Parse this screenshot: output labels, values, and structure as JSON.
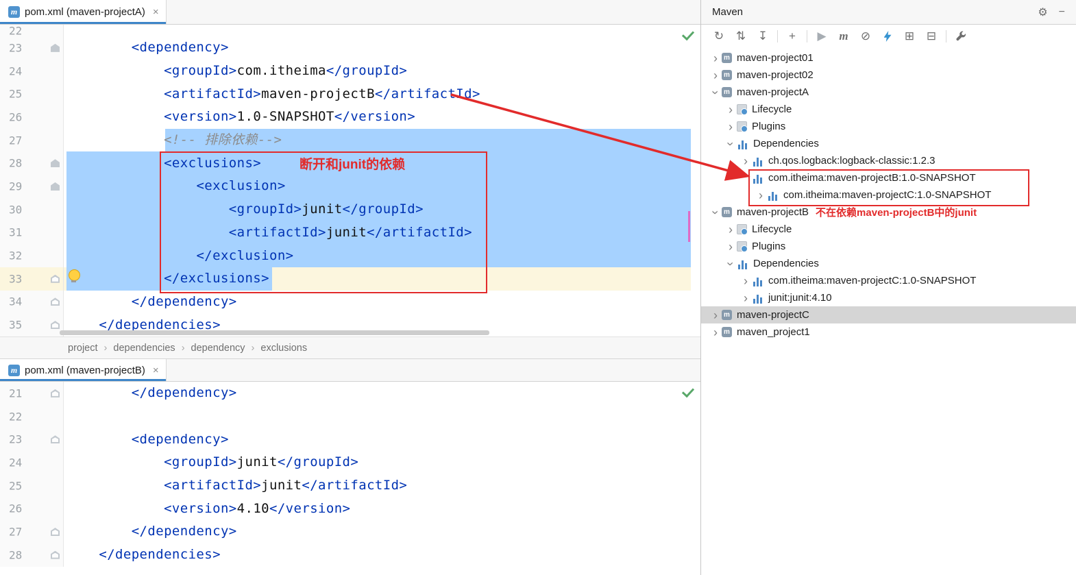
{
  "colors": {
    "accent_blue": "#3e86c9",
    "selection": "#a6d2ff",
    "caret_row": "#fcf6de",
    "error_red": "#e22b2b",
    "tag_blue": "#0033b3",
    "comment_gray": "#8c8c8c",
    "check_green": "#59a869",
    "bars_blue": "#4a88c7"
  },
  "icons": {
    "close": "×",
    "maven_file": "m",
    "module_letter": "m"
  },
  "top_window": {
    "tab": {
      "title": "pom.xml (maven-projectA)"
    },
    "annotation": "断开和junit的依赖",
    "breadcrumb": [
      "project",
      "dependencies",
      "dependency",
      "exclusions"
    ],
    "lines": [
      {
        "no": 22,
        "h": 17
      },
      {
        "no": 23,
        "ind": 8,
        "icon": "filled",
        "seg": [
          {
            "k": "tag",
            "t": "<dependency>"
          }
        ]
      },
      {
        "no": 24,
        "ind": 12,
        "seg": [
          {
            "k": "tag",
            "t": "<groupId>"
          },
          {
            "k": "txt",
            "t": "com.itheima"
          },
          {
            "k": "tag",
            "t": "</groupId>"
          }
        ]
      },
      {
        "no": 25,
        "ind": 12,
        "seg": [
          {
            "k": "tag",
            "t": "<artifactId>"
          },
          {
            "k": "txt",
            "t": "maven-projectB"
          },
          {
            "k": "tag",
            "t": "</artifactId>"
          }
        ]
      },
      {
        "no": 26,
        "ind": 12,
        "seg": [
          {
            "k": "tag",
            "t": "<version>"
          },
          {
            "k": "txt",
            "t": "1.0-SNAPSHOT"
          },
          {
            "k": "tag",
            "t": "</version>"
          }
        ]
      },
      {
        "no": 27,
        "ind": 12,
        "sel": {
          "from": 12,
          "to": "end"
        },
        "seg": [
          {
            "k": "com",
            "t": "<!-- 排除依赖-->"
          }
        ]
      },
      {
        "no": 28,
        "ind": 12,
        "icon": "filled",
        "sel": {
          "from": 0,
          "to": "end"
        },
        "seg": [
          {
            "k": "tag",
            "t": "<exclusions>"
          }
        ]
      },
      {
        "no": 29,
        "ind": 16,
        "icon": "filled",
        "sel": {
          "from": 0,
          "to": "end"
        },
        "seg": [
          {
            "k": "tag",
            "t": "<exclusion>"
          }
        ]
      },
      {
        "no": 30,
        "ind": 20,
        "sel": {
          "from": 0,
          "to": "end"
        },
        "seg": [
          {
            "k": "tag",
            "t": "<groupId>"
          },
          {
            "k": "txt",
            "t": "junit"
          },
          {
            "k": "tag",
            "t": "</groupId>"
          }
        ]
      },
      {
        "no": 31,
        "ind": 20,
        "sel": {
          "from": 0,
          "to": "end"
        },
        "seg": [
          {
            "k": "tag",
            "t": "<artifactId>"
          },
          {
            "k": "txt",
            "t": "junit"
          },
          {
            "k": "tag",
            "t": "</artifactId>"
          }
        ]
      },
      {
        "no": 32,
        "ind": 16,
        "sel": {
          "from": 0,
          "to": "end"
        },
        "seg": [
          {
            "k": "tag",
            "t": "</exclusion>"
          }
        ]
      },
      {
        "no": 33,
        "ind": 12,
        "icon": "outline",
        "caret": true,
        "sel": {
          "from": 0,
          "to": 25
        },
        "seg": [
          {
            "k": "tag",
            "t": "</exclusions>"
          }
        ]
      },
      {
        "no": 34,
        "ind": 8,
        "icon": "outline",
        "seg": [
          {
            "k": "tag",
            "t": "</dependency>"
          }
        ]
      },
      {
        "no": 35,
        "ind": 4,
        "icon": "outline",
        "seg": [
          {
            "k": "tag",
            "t": "</dependencies>"
          }
        ]
      }
    ]
  },
  "bottom_window": {
    "tab": {
      "title": "pom.xml (maven-projectB)"
    },
    "lines": [
      {
        "no": 21,
        "ind": 8,
        "icon": "outline",
        "seg": [
          {
            "k": "tag",
            "t": "</dependency>"
          }
        ]
      },
      {
        "no": 22
      },
      {
        "no": 23,
        "ind": 8,
        "icon": "outline",
        "seg": [
          {
            "k": "tag",
            "t": "<dependency>"
          }
        ]
      },
      {
        "no": 24,
        "ind": 12,
        "seg": [
          {
            "k": "tag",
            "t": "<groupId>"
          },
          {
            "k": "txt",
            "t": "junit"
          },
          {
            "k": "tag",
            "t": "</groupId>"
          }
        ]
      },
      {
        "no": 25,
        "ind": 12,
        "seg": [
          {
            "k": "tag",
            "t": "<artifactId>"
          },
          {
            "k": "txt",
            "t": "junit"
          },
          {
            "k": "tag",
            "t": "</artifactId>"
          }
        ]
      },
      {
        "no": 26,
        "ind": 12,
        "seg": [
          {
            "k": "tag",
            "t": "<version>"
          },
          {
            "k": "txt",
            "t": "4.10"
          },
          {
            "k": "tag",
            "t": "</version>"
          }
        ]
      },
      {
        "no": 27,
        "ind": 8,
        "icon": "outline",
        "seg": [
          {
            "k": "tag",
            "t": "</dependency>"
          }
        ]
      },
      {
        "no": 28,
        "ind": 4,
        "icon": "outline",
        "seg": [
          {
            "k": "tag",
            "t": "</dependencies>"
          }
        ]
      }
    ]
  },
  "maven_panel": {
    "title": "Maven",
    "gear_glyph": "⚙",
    "minimize_glyph": "−",
    "annotation": "不在依赖maven-projectB中的junit",
    "toolbar": [
      {
        "name": "reimport-icon",
        "g": "↻"
      },
      {
        "name": "generate-sources-icon",
        "g": "⇅"
      },
      {
        "name": "download-sources-icon",
        "g": "↧"
      },
      {
        "sep": true
      },
      {
        "name": "add-maven-project-icon",
        "g": "+"
      },
      {
        "sep": true
      },
      {
        "name": "run-build-icon",
        "g": "▶",
        "muted": true
      },
      {
        "name": "execute-goal-icon",
        "g": "m",
        "italic": true
      },
      {
        "name": "skip-tests-icon",
        "g": "⊘"
      },
      {
        "name": "offline-mode-icon",
        "g": "bolt"
      },
      {
        "name": "expand-all-icon",
        "g": "⊞"
      },
      {
        "name": "collapse-all-icon",
        "g": "⊟"
      },
      {
        "sep": true
      },
      {
        "name": "maven-settings-icon",
        "g": "wrench"
      }
    ],
    "tree": [
      {
        "label": "maven-project01",
        "level": 0,
        "chev": "r",
        "icon": "module"
      },
      {
        "label": "maven-project02",
        "level": 0,
        "chev": "r",
        "icon": "module"
      },
      {
        "label": "maven-projectA",
        "level": 0,
        "chev": "d",
        "icon": "module"
      },
      {
        "label": "Lifecycle",
        "level": 1,
        "chev": "r",
        "icon": "box"
      },
      {
        "label": "Plugins",
        "level": 1,
        "chev": "r",
        "icon": "box"
      },
      {
        "label": "Dependencies",
        "level": 1,
        "chev": "d",
        "icon": "bars"
      },
      {
        "label": "ch.qos.logback:logback-classic:1.2.3",
        "level": 2,
        "chev": "r",
        "icon": "bars"
      },
      {
        "label": "com.itheima:maven-projectB:1.0-SNAPSHOT",
        "level": 2,
        "chev": "",
        "icon": "bars"
      },
      {
        "label": "com.itheima:maven-projectC:1.0-SNAPSHOT",
        "level": 3,
        "chev": "r",
        "icon": "bars"
      },
      {
        "label": "maven-projectB",
        "level": 0,
        "chev": "d",
        "icon": "module",
        "annot": true
      },
      {
        "label": "Lifecycle",
        "level": 1,
        "chev": "r",
        "icon": "box"
      },
      {
        "label": "Plugins",
        "level": 1,
        "chev": "r",
        "icon": "box"
      },
      {
        "label": "Dependencies",
        "level": 1,
        "chev": "d",
        "icon": "bars"
      },
      {
        "label": "com.itheima:maven-projectC:1.0-SNAPSHOT",
        "level": 2,
        "chev": "r",
        "icon": "bars"
      },
      {
        "label": "junit:junit:4.10",
        "level": 2,
        "chev": "r",
        "icon": "bars"
      },
      {
        "label": "maven-projectC",
        "level": 0,
        "chev": "r",
        "icon": "module",
        "selected": true
      },
      {
        "label": "maven_project1",
        "level": 0,
        "chev": "r",
        "icon": "module"
      }
    ]
  }
}
